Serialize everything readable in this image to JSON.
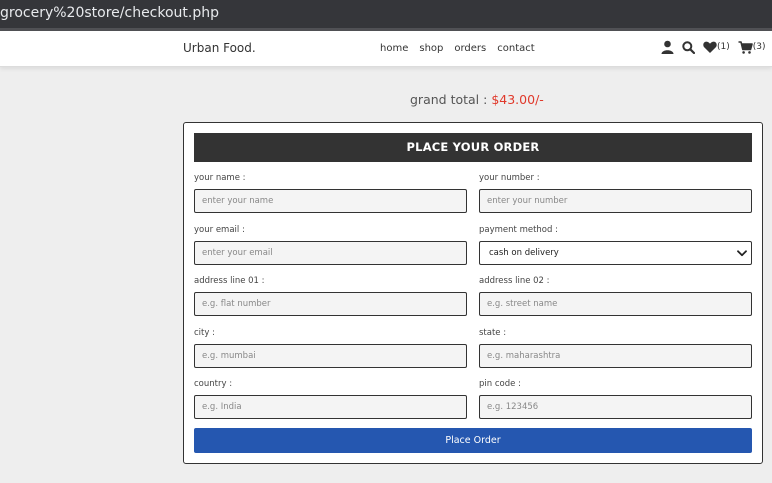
{
  "browser": {
    "url": "grocery%20store/checkout.php"
  },
  "navbar": {
    "logo": "Urban Food.",
    "links": [
      "home",
      "shop",
      "orders",
      "contact"
    ],
    "icons": [
      "user-icon",
      "search-icon",
      "heart-icon",
      "cart-icon"
    ],
    "wishlist_count": "(1)",
    "cart_count": "(3)"
  },
  "checkout": {
    "grand_total_label": "grand total :",
    "grand_total_value": "$43.00/-",
    "form_title": "PLACE YOUR ORDER",
    "fields": {
      "name": {
        "label": "your name :",
        "placeholder": "enter your name"
      },
      "number": {
        "label": "your number :",
        "placeholder": "enter your number"
      },
      "email": {
        "label": "your email :",
        "placeholder": "enter your email"
      },
      "payment": {
        "label": "payment method :",
        "value": "cash on delivery"
      },
      "address1": {
        "label": "address line 01 :",
        "placeholder": "e.g. flat number"
      },
      "address2": {
        "label": "address line 02 :",
        "placeholder": "e.g. street name"
      },
      "city": {
        "label": "city :",
        "placeholder": "e.g. mumbai"
      },
      "state": {
        "label": "state :",
        "placeholder": "e.g. maharashtra"
      },
      "country": {
        "label": "country :",
        "placeholder": "e.g. India"
      },
      "pincode": {
        "label": "pin code :",
        "placeholder": "e.g. 123456"
      }
    },
    "submit_label": "Place Order"
  },
  "colors": {
    "accent": "#2557b0",
    "price": "#e0392b",
    "title_bg": "#333333"
  }
}
